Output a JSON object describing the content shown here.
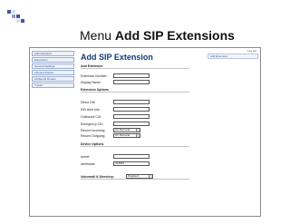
{
  "slide_title": {
    "prefix": "Menu ",
    "emphasis": "Add SIP Extensions"
  },
  "bullet_colors": [
    "#3b5aa8",
    "#d9e0ef",
    "#8da0cc"
  ],
  "logout": "Log out",
  "nav": {
    "items": [
      "Administrators",
      "Extensions",
      "General Settings",
      "Inbound Routes",
      "Outbound Routes",
      "Trunks"
    ]
  },
  "page_title": "Add SIP Extension",
  "right_panel": "Add Extension",
  "sections": {
    "add_extension": "Add Extension",
    "extension_options": "Extension Options",
    "device_options": "Device Options",
    "dtmf_label": "Voicemail & Directory:"
  },
  "fields": {
    "extension_number": {
      "label": "Extension Number",
      "value": ""
    },
    "display_name": {
      "label": "Display Name",
      "value": ""
    },
    "direct_did": {
      "label": "Direct DID",
      "value": ""
    },
    "did_alert_info": {
      "label": "DID Alert Info",
      "value": ""
    },
    "outbound_cid": {
      "label": "Outbound CID",
      "value": ""
    },
    "emergency_cid": {
      "label": "Emergency CID",
      "value": ""
    },
    "record_incoming": {
      "label": "Record Incoming",
      "value": "On Demand"
    },
    "record_outgoing": {
      "label": "Record Outgoing",
      "value": "On Demand"
    },
    "secret": {
      "label": "secret",
      "value": ""
    },
    "dtmfmode": {
      "label": "dtmfmode",
      "value": "rfc2833"
    },
    "voicemail": {
      "value": "Disabled"
    }
  }
}
